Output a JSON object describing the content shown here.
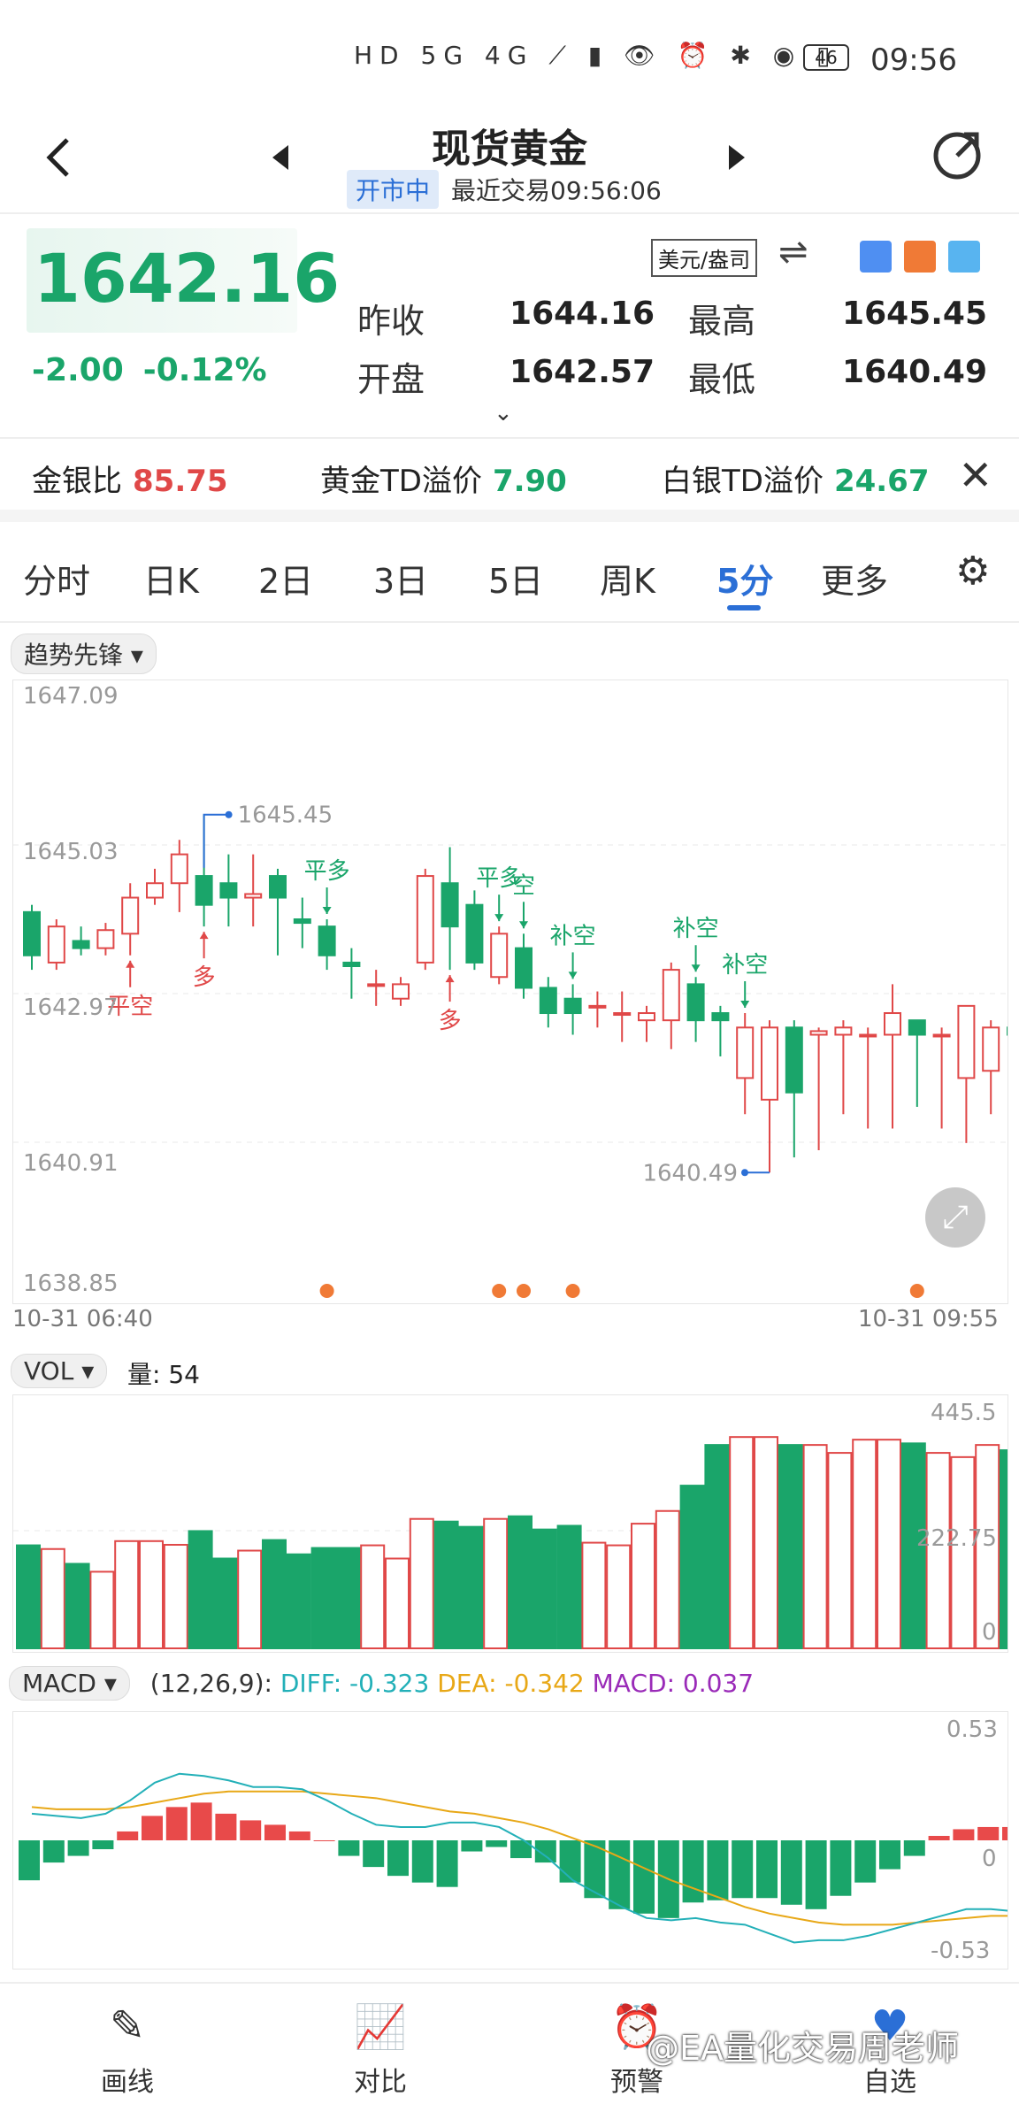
{
  "status_bar": {
    "time": "09:56",
    "icons": "HD 5G 4G ⟋ ▮ 👁 ⏰ ✱ ◉ ▯",
    "battery": "46"
  },
  "header": {
    "title": "现货黄金",
    "status_badge": "开市中",
    "last_trade": "最近交易09:56:06"
  },
  "quote": {
    "price": "1642.16",
    "change": "-2.00",
    "change_pct": "-0.12%",
    "unit": "美元/盎司",
    "prev_close_label": "昨收",
    "prev_close": "1644.16",
    "high_label": "最高",
    "high": "1645.45",
    "open_label": "开盘",
    "open": "1642.57",
    "low_label": "最低",
    "low": "1640.49",
    "color_down": "#1aa56a",
    "color_up": "#e04848"
  },
  "ratios": {
    "gold_silver_label": "金银比",
    "gold_silver": "85.75",
    "gold_td_label": "黄金TD溢价",
    "gold_td": "7.90",
    "silver_td_label": "白银TD溢价",
    "silver_td": "24.67"
  },
  "tabs": [
    {
      "label": "分时"
    },
    {
      "label": "日K"
    },
    {
      "label": "2日"
    },
    {
      "label": "3日"
    },
    {
      "label": "5日"
    },
    {
      "label": "周K"
    },
    {
      "label": "5分"
    },
    {
      "label": "更多"
    }
  ],
  "indicator": {
    "label": "趋势先锋 ▾"
  },
  "vol": {
    "label": "VOL ▾",
    "amount_text": "量: 54"
  },
  "macd": {
    "label": "MACD ▾",
    "params": "(12,26,9):",
    "diff": "DIFF: -0.323",
    "dea": "DEA: -0.342",
    "value": "MACD: 0.037"
  },
  "bottom_nav": [
    {
      "label": "画线",
      "icon": "pen-icon"
    },
    {
      "label": "对比",
      "icon": "compare-chart-icon"
    },
    {
      "label": "预警",
      "icon": "alarm-icon"
    },
    {
      "label": "自选",
      "icon": "heart-icon"
    }
  ],
  "watermark": "@EA量化交易周老师",
  "chart_data": [
    {
      "type": "candlestick",
      "title": "",
      "y_ticks": [
        "1647.09",
        "1645.03",
        "1642.97",
        "1640.91",
        "1638.85"
      ],
      "ylim": [
        1638.85,
        1647.09
      ],
      "x_start_label": "10-31 06:40",
      "x_end_label": "10-31 09:55",
      "max_label": "1645.45",
      "min_label": "1640.49",
      "candles": [
        {
          "o": 1644.1,
          "c": 1643.5,
          "h": 1644.2,
          "l": 1643.3
        },
        {
          "o": 1643.4,
          "c": 1643.9,
          "h": 1644.0,
          "l": 1643.3
        },
        {
          "o": 1643.7,
          "c": 1643.6,
          "h": 1643.9,
          "l": 1643.5
        },
        {
          "o": 1643.6,
          "c": 1643.85,
          "h": 1643.95,
          "l": 1643.5
        },
        {
          "o": 1643.8,
          "c": 1644.3,
          "h": 1644.5,
          "l": 1643.5
        },
        {
          "o": 1644.3,
          "c": 1644.5,
          "h": 1644.7,
          "l": 1644.2
        },
        {
          "o": 1644.5,
          "c": 1644.9,
          "h": 1645.1,
          "l": 1644.1
        },
        {
          "o": 1644.6,
          "c": 1644.2,
          "h": 1645.45,
          "l": 1643.9
        },
        {
          "o": 1644.5,
          "c": 1644.3,
          "h": 1644.9,
          "l": 1643.9
        },
        {
          "o": 1644.3,
          "c": 1644.35,
          "h": 1644.9,
          "l": 1643.9
        },
        {
          "o": 1644.6,
          "c": 1644.3,
          "h": 1644.7,
          "l": 1643.5
        },
        {
          "o": 1644.0,
          "c": 1643.95,
          "h": 1644.3,
          "l": 1643.6
        },
        {
          "o": 1643.9,
          "c": 1643.5,
          "h": 1644.0,
          "l": 1643.3
        },
        {
          "o": 1643.4,
          "c": 1643.35,
          "h": 1643.6,
          "l": 1642.9
        },
        {
          "o": 1643.1,
          "c": 1643.1,
          "h": 1643.3,
          "l": 1642.8
        },
        {
          "o": 1642.9,
          "c": 1643.1,
          "h": 1643.2,
          "l": 1642.8
        },
        {
          "o": 1643.4,
          "c": 1644.6,
          "h": 1644.7,
          "l": 1643.3
        },
        {
          "o": 1644.5,
          "c": 1643.9,
          "h": 1645.0,
          "l": 1643.3
        },
        {
          "o": 1644.2,
          "c": 1643.4,
          "h": 1644.4,
          "l": 1643.3
        },
        {
          "o": 1643.2,
          "c": 1643.8,
          "h": 1643.9,
          "l": 1643.1
        },
        {
          "o": 1643.6,
          "c": 1643.05,
          "h": 1643.8,
          "l": 1642.9
        },
        {
          "o": 1643.05,
          "c": 1642.7,
          "h": 1643.2,
          "l": 1642.5
        },
        {
          "o": 1642.9,
          "c": 1642.7,
          "h": 1643.1,
          "l": 1642.4
        },
        {
          "o": 1642.8,
          "c": 1642.8,
          "h": 1643.0,
          "l": 1642.5
        },
        {
          "o": 1642.7,
          "c": 1642.7,
          "h": 1643.0,
          "l": 1642.3
        },
        {
          "o": 1642.6,
          "c": 1642.7,
          "h": 1642.8,
          "l": 1642.3
        },
        {
          "o": 1642.6,
          "c": 1643.3,
          "h": 1643.4,
          "l": 1642.2
        },
        {
          "o": 1643.1,
          "c": 1642.6,
          "h": 1643.2,
          "l": 1642.3
        },
        {
          "o": 1642.7,
          "c": 1642.6,
          "h": 1642.8,
          "l": 1642.1
        },
        {
          "o": 1641.8,
          "c": 1642.5,
          "h": 1642.7,
          "l": 1641.3
        },
        {
          "o": 1641.5,
          "c": 1642.5,
          "h": 1642.6,
          "l": 1640.49
        },
        {
          "o": 1642.5,
          "c": 1641.6,
          "h": 1642.6,
          "l": 1640.7
        },
        {
          "o": 1642.4,
          "c": 1642.45,
          "h": 1642.5,
          "l": 1640.8
        },
        {
          "o": 1642.4,
          "c": 1642.5,
          "h": 1642.6,
          "l": 1641.3
        },
        {
          "o": 1642.4,
          "c": 1642.4,
          "h": 1642.5,
          "l": 1641.1
        },
        {
          "o": 1642.4,
          "c": 1642.7,
          "h": 1643.1,
          "l": 1641.1
        },
        {
          "o": 1642.6,
          "c": 1642.4,
          "h": 1642.6,
          "l": 1641.4
        },
        {
          "o": 1642.4,
          "c": 1642.4,
          "h": 1642.5,
          "l": 1641.1
        },
        {
          "o": 1641.8,
          "c": 1642.8,
          "h": 1642.8,
          "l": 1640.9
        },
        {
          "o": 1641.9,
          "c": 1642.5,
          "h": 1642.6,
          "l": 1641.3
        },
        {
          "o": 1642.5,
          "c": 1642.4,
          "h": 1642.6,
          "l": 1641.1
        },
        {
          "o": 1641.8,
          "c": 1642.2,
          "h": 1642.4,
          "l": 1641.3
        }
      ],
      "signals": [
        {
          "i": 4,
          "text": "平空",
          "dir": "up"
        },
        {
          "i": 7,
          "text": "多",
          "dir": "up"
        },
        {
          "i": 12,
          "text": "平多",
          "dir": "down"
        },
        {
          "i": 17,
          "text": "多",
          "dir": "up"
        },
        {
          "i": 19,
          "text": "平多",
          "dir": "down"
        },
        {
          "i": 20,
          "text": "空",
          "dir": "down"
        },
        {
          "i": 22,
          "text": "补空",
          "dir": "down"
        },
        {
          "i": 27,
          "text": "补空",
          "dir": "down"
        },
        {
          "i": 29,
          "text": "补空",
          "dir": "down"
        }
      ],
      "signal_dots": [
        12,
        19,
        20,
        22,
        36
      ]
    },
    {
      "type": "bar",
      "title": "VOL",
      "y_ticks": [
        "445.5",
        "222.75",
        "0"
      ],
      "ylim": [
        0,
        445.5
      ],
      "values": [
        195,
        188,
        160,
        145,
        203,
        203,
        196,
        222,
        170,
        185,
        205,
        178,
        190,
        190,
        195,
        170,
        245,
        240,
        230,
        245,
        250,
        225,
        232,
        200,
        195,
        236,
        260,
        308,
        385,
        400,
        400,
        385,
        385,
        370,
        395,
        395,
        388,
        370,
        362,
        385,
        375,
        54
      ]
    },
    {
      "type": "bar",
      "title": "MACD",
      "y_ticks": [
        "0.53",
        "0",
        "-0.53"
      ],
      "ylim": [
        -0.53,
        0.53
      ],
      "histogram": [
        -0.18,
        -0.1,
        -0.07,
        -0.04,
        0.04,
        0.11,
        0.15,
        0.17,
        0.12,
        0.09,
        0.07,
        0.04,
        0.0,
        -0.07,
        -0.12,
        -0.16,
        -0.19,
        -0.21,
        -0.05,
        -0.03,
        -0.08,
        -0.1,
        -0.19,
        -0.26,
        -0.31,
        -0.33,
        -0.35,
        -0.28,
        -0.27,
        -0.26,
        -0.26,
        -0.29,
        -0.31,
        -0.25,
        -0.19,
        -0.13,
        -0.07,
        0.02,
        0.05,
        0.06,
        0.06,
        0.037
      ],
      "diff": [
        0.12,
        0.11,
        0.1,
        0.12,
        0.18,
        0.26,
        0.3,
        0.29,
        0.27,
        0.24,
        0.24,
        0.23,
        0.18,
        0.12,
        0.07,
        0.06,
        0.06,
        0.08,
        0.08,
        0.06,
        0.0,
        -0.08,
        -0.18,
        -0.24,
        -0.3,
        -0.35,
        -0.36,
        -0.35,
        -0.37,
        -0.38,
        -0.42,
        -0.46,
        -0.45,
        -0.45,
        -0.43,
        -0.4,
        -0.37,
        -0.34,
        -0.31,
        -0.31,
        -0.32,
        -0.323
      ],
      "dea": [
        0.15,
        0.14,
        0.14,
        0.14,
        0.15,
        0.17,
        0.19,
        0.21,
        0.22,
        0.22,
        0.22,
        0.22,
        0.21,
        0.2,
        0.19,
        0.17,
        0.15,
        0.13,
        0.12,
        0.1,
        0.08,
        0.05,
        0.01,
        -0.03,
        -0.08,
        -0.13,
        -0.18,
        -0.22,
        -0.26,
        -0.3,
        -0.33,
        -0.35,
        -0.37,
        -0.38,
        -0.38,
        -0.38,
        -0.37,
        -0.36,
        -0.35,
        -0.34,
        -0.34,
        -0.342
      ],
      "colors": {
        "diff": "#23b0b8",
        "dea": "#e8a817",
        "hist_up": "#e84a4a",
        "hist_down": "#1aa56a"
      }
    }
  ]
}
